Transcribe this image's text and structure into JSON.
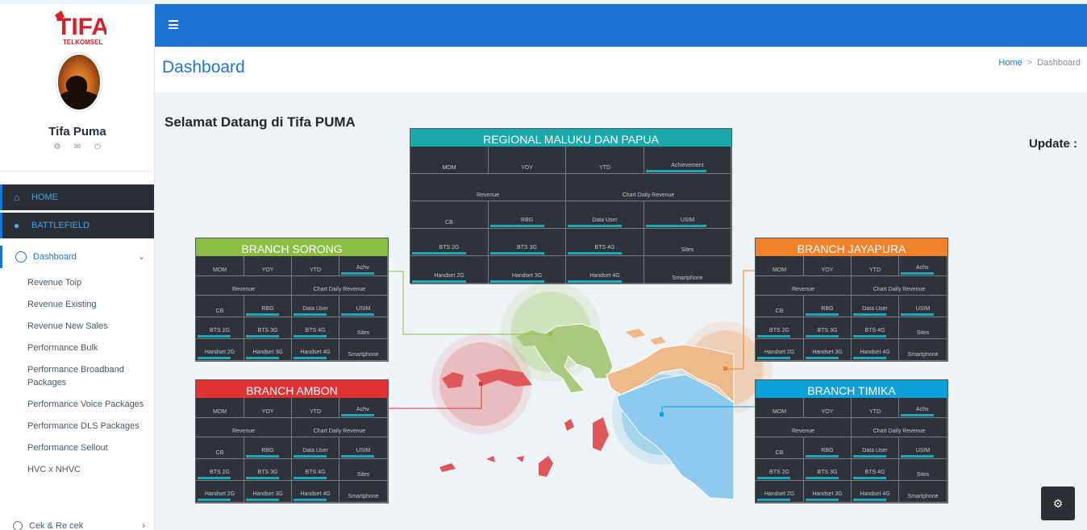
{
  "brand": {
    "logo_text": "TIFA",
    "logo_sub": "TELKOMSEL",
    "logo_color": "#d6202a"
  },
  "user": {
    "name": "Tifa Puma",
    "icons": [
      "gear-icon",
      "mail-icon",
      "power-icon"
    ]
  },
  "sidebar": {
    "home_label": "HOME",
    "battlefield_label": "BATTLEFIELD",
    "dashboard_label": "Dashboard",
    "submenu": [
      "Revenue Toip",
      "Revenue Existing",
      "Revenue New Sales",
      "Performance Bulk",
      "Performance Broadband Packages",
      "Performance Voice Packages",
      "Performance DLS Packages",
      "Performance Sellout",
      "HVC x NHVC"
    ],
    "cek_label": "Cek & Re cek"
  },
  "header": {
    "title": "Dashboard",
    "breadcrumb_home": "Home",
    "breadcrumb_sep": ">",
    "breadcrumb_current": "Dashboard"
  },
  "welcome": "Selamat Datang di Tifa PUMA",
  "update_label": "Update :",
  "colors": {
    "primary": "#1b74d3",
    "sorong": "#8bbd45",
    "ambon": "#e03233",
    "jayapura": "#f0822b",
    "timika": "#0ea0d8",
    "regional": "#1aa9aa",
    "panel_bg": "#2e3239",
    "bar": "#1ba8b8"
  },
  "regional": {
    "title": "REGIONAL MALUKU DAN PAPUA",
    "cells": [
      "MOM",
      "YOY",
      "YTD",
      "Achievement",
      "Revenue",
      "Chart Daily Revenue",
      "CB",
      "RBG",
      "Data User",
      "USIM",
      "BTS 2G",
      "BTS 3G",
      "BTS 4G",
      "Sites",
      "Handset 2G",
      "Handset 3G",
      "Handset 4G",
      "Smartphone"
    ]
  },
  "branches": {
    "sorong": {
      "title": "BRANCH SORONG"
    },
    "ambon": {
      "title": "BRANCH AMBON"
    },
    "jayapura": {
      "title": "BRANCH JAYAPURA"
    },
    "timika": {
      "title": "BRANCH TIMIKA"
    }
  },
  "branch_cells": [
    "MOM",
    "YOY",
    "YTD",
    "Achv.",
    "Revenue",
    "Chart Daily Revenue",
    "CB",
    "RBG",
    "Data User",
    "USIM",
    "BTS 2G",
    "BTS 3G",
    "BTS 4G",
    "Sites",
    "Handset 2G",
    "Handset 3G",
    "Handset 4G",
    "Smartphone"
  ]
}
